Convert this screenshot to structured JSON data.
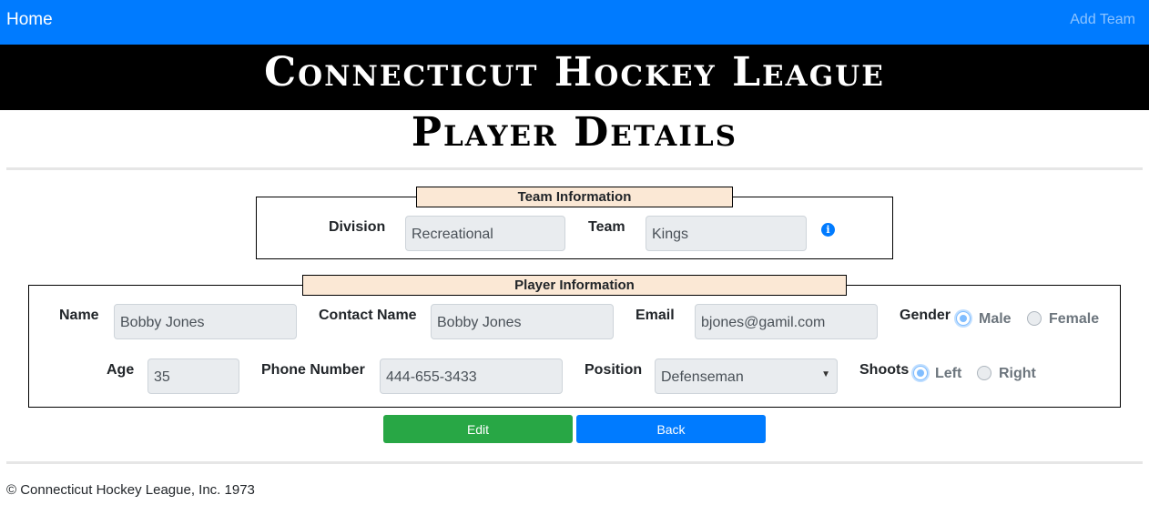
{
  "nav": {
    "home": "Home",
    "add_team": "Add Team"
  },
  "banner_title": "Connecticut Hockey League",
  "page_title": "Player Details",
  "team_info": {
    "legend": "Team Information",
    "division_label": "Division",
    "division_value": "Recreational",
    "team_label": "Team",
    "team_value": "Kings",
    "info_icon": "info-circle-icon"
  },
  "player_info": {
    "legend": "Player Information",
    "name_label": "Name",
    "name_value": "Bobby Jones",
    "contact_label": "Contact Name",
    "contact_value": "Bobby Jones",
    "email_label": "Email",
    "email_value": "bjones@gamil.com",
    "gender_label": "Gender",
    "gender_options": [
      "Male",
      "Female"
    ],
    "gender_selected": "Male",
    "age_label": "Age",
    "age_value": "35",
    "phone_label": "Phone Number",
    "phone_value": "444-655-3433",
    "position_label": "Position",
    "position_value": "Defenseman",
    "shoots_label": "Shoots",
    "shoots_options": [
      "Left",
      "Right"
    ],
    "shoots_selected": "Left"
  },
  "buttons": {
    "edit": "Edit",
    "back": "Back"
  },
  "footer": "© Connecticut Hockey League, Inc. 1973",
  "colors": {
    "navbar": "#007bff",
    "banner": "#000000",
    "legend_bg": "#fbe8d5",
    "edit_button": "#28a745",
    "back_button": "#007bff"
  }
}
